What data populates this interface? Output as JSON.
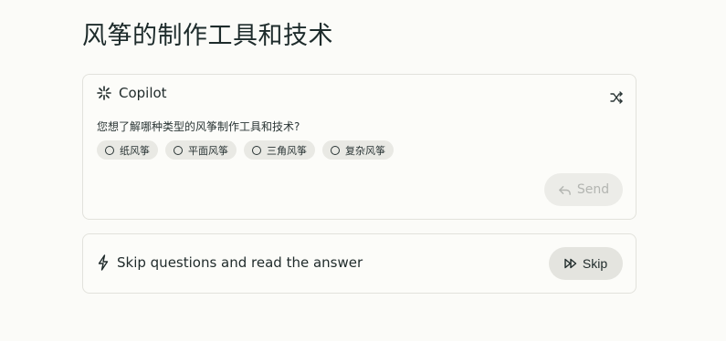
{
  "page": {
    "title": "风筝的制作工具和技术"
  },
  "copilot": {
    "title": "Copilot",
    "icon": "copilot-sparkle-icon",
    "shuffle_icon": "shuffle-icon",
    "question": "您想了解哪种类型的风筝制作工具和技术?",
    "options": [
      {
        "label": "纸风筝"
      },
      {
        "label": "平面风筝"
      },
      {
        "label": "三角风筝"
      },
      {
        "label": "复杂风筝"
      }
    ],
    "send_label": "Send",
    "send_icon": "reply-arrow-icon"
  },
  "skip": {
    "text": "Skip questions and read the answer",
    "icon": "lightning-bolt-icon",
    "button_label": "Skip",
    "button_icon": "fast-forward-icon"
  },
  "colors": {
    "background": "#fbfbf8",
    "card_border": "#e2e2dc",
    "chip_bg": "#e9e9e4",
    "send_disabled_text": "#b3b5b1",
    "skip_button_bg": "#e4e4df",
    "text": "#1f2a2a"
  }
}
